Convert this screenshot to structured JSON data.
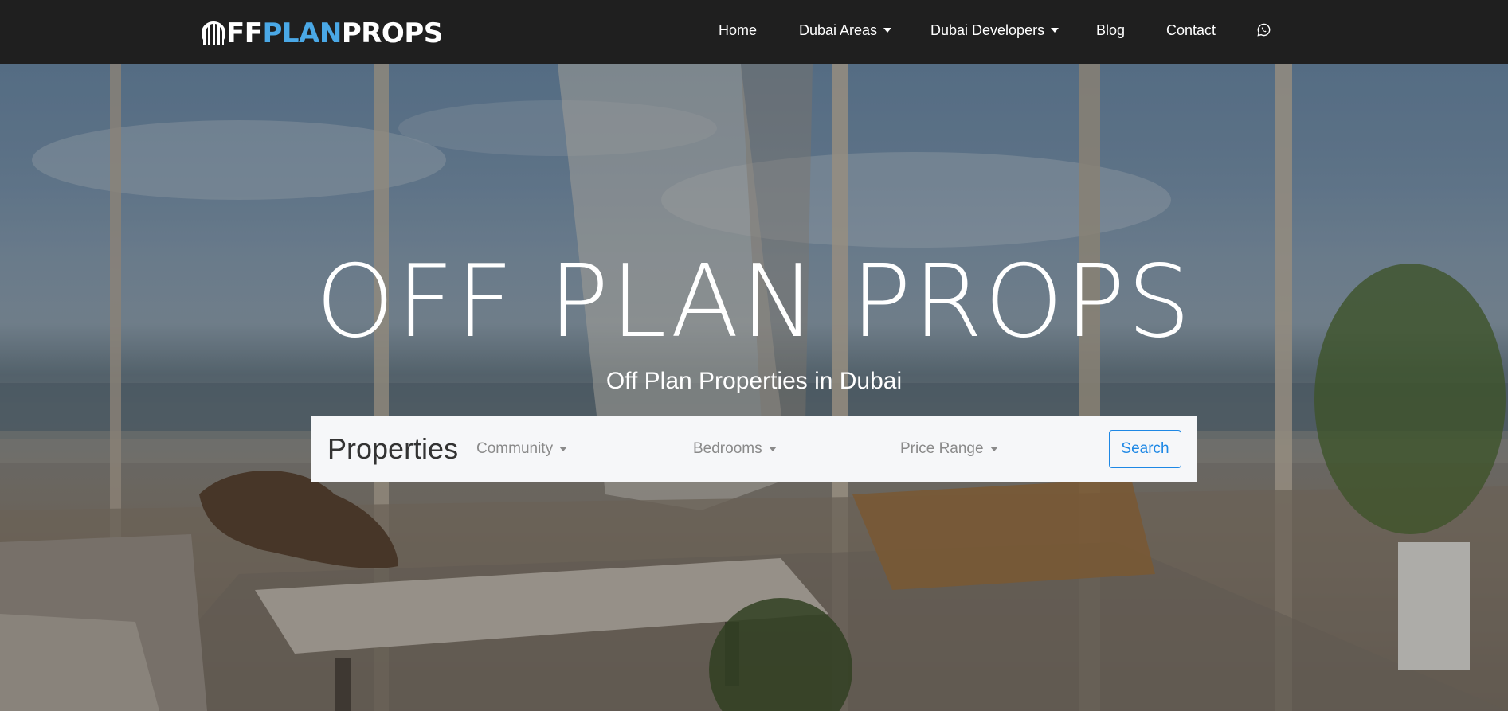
{
  "brand": {
    "logo_prefix": "FF",
    "logo_accent": "PLAN",
    "logo_suffix": "PROPS",
    "accent_color": "#4aa8e6"
  },
  "nav": {
    "items": [
      {
        "label": "Home",
        "has_dropdown": false
      },
      {
        "label": "Dubai Areas",
        "has_dropdown": true
      },
      {
        "label": "Dubai Developers",
        "has_dropdown": true
      },
      {
        "label": "Blog",
        "has_dropdown": false
      },
      {
        "label": "Contact",
        "has_dropdown": false
      }
    ],
    "whatsapp_icon": "whatsapp-icon",
    "background": "#1f1f1f"
  },
  "hero": {
    "title": "OFF PLAN PROPS",
    "subtitle": "Off Plan Properties in Dubai",
    "background_description_icon": "luxury-apartment-sea-view-image"
  },
  "search": {
    "brand_label": "Properties",
    "filters": [
      {
        "label": "Community"
      },
      {
        "label": "Bedrooms"
      },
      {
        "label": "Price Range"
      }
    ],
    "button_label": "Search",
    "button_color": "#1e88e5"
  }
}
